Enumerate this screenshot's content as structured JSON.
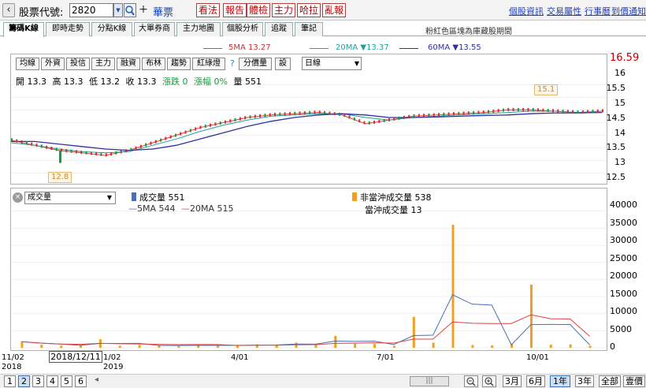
{
  "topbar": {
    "back": "‹",
    "stock_label": "股票代號:",
    "stock_code": "2820",
    "stock_name": "華票",
    "buttons": [
      "看法",
      "報告",
      "體檢",
      "主力",
      "哈拉",
      "亂報"
    ],
    "links": [
      "個股資訊",
      "交易屬性",
      "行事曆",
      "到價通知"
    ]
  },
  "tabs": {
    "items": [
      "籌碼K線",
      "即時走勢",
      "分點K線",
      "大單券商",
      "主力地圖",
      "個股分析",
      "追蹤",
      "筆記"
    ],
    "active_index": 0,
    "note": "粉紅色區塊為庫藏股期間"
  },
  "ma_legend": {
    "ma5": "5MA 13.27",
    "ma20": "20MA ▼13.37",
    "ma60": "60MA ▼13.55",
    "colors": {
      "ma5": "#e04040",
      "ma20": "#20a0a0",
      "ma60": "#3030a0"
    }
  },
  "toolbar": {
    "buttons": [
      "均線",
      "外資",
      "投信",
      "主力",
      "融資",
      "布林",
      "趨勢",
      "紅綠燈"
    ],
    "help": "?",
    "fenjia": "分價量",
    "setting": "設",
    "period": "日線"
  },
  "info": {
    "open": "開 13.3",
    "high": "高 13.3",
    "low": "低 13.2",
    "close": "收 13.3",
    "change": "漲跌 0",
    "pct": "漲幅 0%",
    "volume": "量 551"
  },
  "price_axis": {
    "last": "16.59",
    "ticks": [
      "16",
      "15.5",
      "15",
      "14.5",
      "14",
      "13.5",
      "13",
      "12.5"
    ],
    "high_marker": "15.1",
    "low_marker": "12.8",
    "range": [
      12.2,
      16.7
    ]
  },
  "volume": {
    "selector": "成交量",
    "close_icon": "×",
    "legend_total": "成交量 551",
    "legend_ma": "5MA 544",
    "legend_ma20": "20MA 515",
    "legend_non_daytrade": "非當沖成交量 538",
    "legend_daytrade": "當沖成交量 13",
    "ticks": [
      "40000",
      "35000",
      "30000",
      "25000",
      "20000",
      "15000",
      "10000",
      "5000",
      "0"
    ],
    "colors": {
      "total": "#4a6fb5",
      "non_daytrade": "#f0a020"
    }
  },
  "dates": {
    "start": "11/02",
    "start_year": "2018",
    "mid1": "1/02",
    "mid1_year": "2019",
    "apr": "4/01",
    "jul": "7/01",
    "oct": "10/01",
    "tooltip": "2018/12/11"
  },
  "bottombar": {
    "pages": [
      "1",
      "2",
      "3",
      "4",
      "5",
      "6"
    ],
    "active_page": 1,
    "scroll_arrow": "◂",
    "scroll_thumb": "|||",
    "ranges": [
      "3月",
      "6月",
      "1年",
      "3年",
      "全部",
      "壹價"
    ],
    "active_range": 2
  },
  "chart_data": {
    "type": "line",
    "series": [
      {
        "name": "5MA",
        "values": [
          13.8,
          13.6,
          13.4,
          13.3,
          13.2,
          13.4,
          13.7,
          14.0,
          14.3,
          14.5,
          14.7,
          14.8,
          14.85,
          14.9,
          14.8,
          14.45,
          14.6,
          14.75,
          14.8,
          14.85,
          14.9,
          15.0,
          15.0,
          14.95,
          14.9,
          14.95
        ]
      },
      {
        "name": "20MA",
        "values": [
          13.7,
          13.6,
          13.45,
          13.35,
          13.3,
          13.35,
          13.6,
          13.85,
          14.15,
          14.4,
          14.6,
          14.75,
          14.8,
          14.85,
          14.85,
          14.7,
          14.6,
          14.7,
          14.75,
          14.8,
          14.85,
          14.9,
          14.95,
          14.95,
          14.9,
          14.9
        ]
      },
      {
        "name": "60MA",
        "values": [
          13.75,
          13.75,
          13.65,
          13.55,
          13.45,
          13.4,
          13.45,
          13.6,
          13.85,
          14.1,
          14.35,
          14.55,
          14.7,
          14.8,
          14.85,
          14.8,
          14.7,
          14.7,
          14.72,
          14.75,
          14.78,
          14.8,
          14.85,
          14.88,
          14.88,
          14.9
        ]
      }
    ],
    "volume_values": [
      1800,
      900,
      600,
      700,
      2500,
      600,
      800,
      700,
      500,
      900,
      700,
      600,
      1000,
      800,
      1500,
      900,
      3500,
      1200,
      1100,
      600,
      9000,
      1500,
      36000,
      800,
      700,
      1100,
      18500,
      900,
      1000,
      600
    ],
    "volume_ylim": [
      0,
      42000
    ],
    "price_ylim": [
      12.2,
      16.7
    ]
  }
}
